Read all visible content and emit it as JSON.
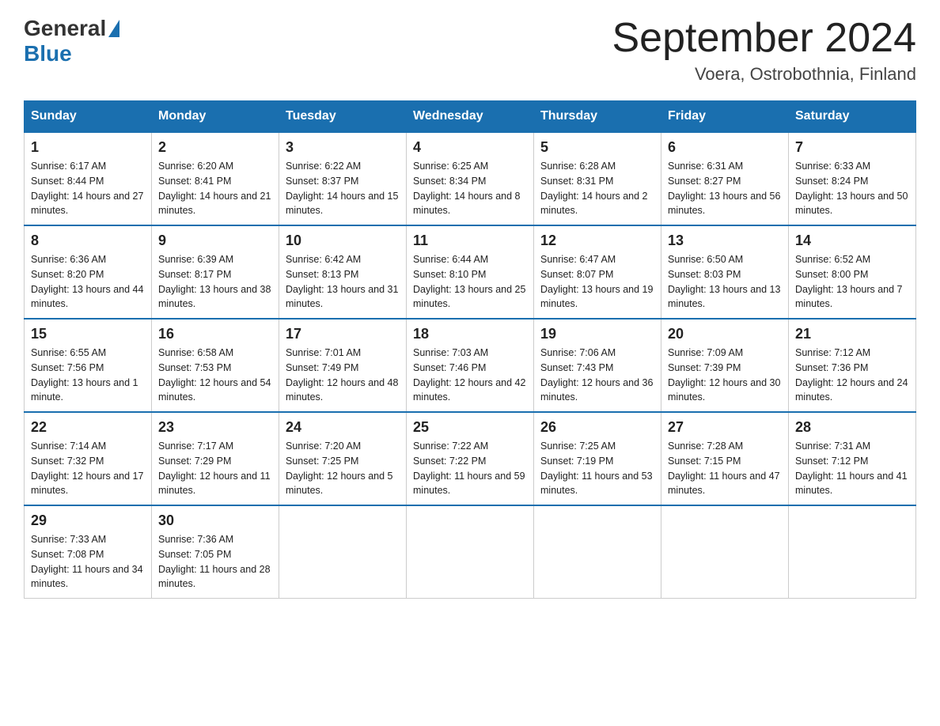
{
  "header": {
    "logo_general": "General",
    "logo_blue": "Blue",
    "month_title": "September 2024",
    "location": "Voera, Ostrobothnia, Finland"
  },
  "days_of_week": [
    "Sunday",
    "Monday",
    "Tuesday",
    "Wednesday",
    "Thursday",
    "Friday",
    "Saturday"
  ],
  "weeks": [
    [
      {
        "day": "1",
        "sunrise": "6:17 AM",
        "sunset": "8:44 PM",
        "daylight": "14 hours and 27 minutes."
      },
      {
        "day": "2",
        "sunrise": "6:20 AM",
        "sunset": "8:41 PM",
        "daylight": "14 hours and 21 minutes."
      },
      {
        "day": "3",
        "sunrise": "6:22 AM",
        "sunset": "8:37 PM",
        "daylight": "14 hours and 15 minutes."
      },
      {
        "day": "4",
        "sunrise": "6:25 AM",
        "sunset": "8:34 PM",
        "daylight": "14 hours and 8 minutes."
      },
      {
        "day": "5",
        "sunrise": "6:28 AM",
        "sunset": "8:31 PM",
        "daylight": "14 hours and 2 minutes."
      },
      {
        "day": "6",
        "sunrise": "6:31 AM",
        "sunset": "8:27 PM",
        "daylight": "13 hours and 56 minutes."
      },
      {
        "day": "7",
        "sunrise": "6:33 AM",
        "sunset": "8:24 PM",
        "daylight": "13 hours and 50 minutes."
      }
    ],
    [
      {
        "day": "8",
        "sunrise": "6:36 AM",
        "sunset": "8:20 PM",
        "daylight": "13 hours and 44 minutes."
      },
      {
        "day": "9",
        "sunrise": "6:39 AM",
        "sunset": "8:17 PM",
        "daylight": "13 hours and 38 minutes."
      },
      {
        "day": "10",
        "sunrise": "6:42 AM",
        "sunset": "8:13 PM",
        "daylight": "13 hours and 31 minutes."
      },
      {
        "day": "11",
        "sunrise": "6:44 AM",
        "sunset": "8:10 PM",
        "daylight": "13 hours and 25 minutes."
      },
      {
        "day": "12",
        "sunrise": "6:47 AM",
        "sunset": "8:07 PM",
        "daylight": "13 hours and 19 minutes."
      },
      {
        "day": "13",
        "sunrise": "6:50 AM",
        "sunset": "8:03 PM",
        "daylight": "13 hours and 13 minutes."
      },
      {
        "day": "14",
        "sunrise": "6:52 AM",
        "sunset": "8:00 PM",
        "daylight": "13 hours and 7 minutes."
      }
    ],
    [
      {
        "day": "15",
        "sunrise": "6:55 AM",
        "sunset": "7:56 PM",
        "daylight": "13 hours and 1 minute."
      },
      {
        "day": "16",
        "sunrise": "6:58 AM",
        "sunset": "7:53 PM",
        "daylight": "12 hours and 54 minutes."
      },
      {
        "day": "17",
        "sunrise": "7:01 AM",
        "sunset": "7:49 PM",
        "daylight": "12 hours and 48 minutes."
      },
      {
        "day": "18",
        "sunrise": "7:03 AM",
        "sunset": "7:46 PM",
        "daylight": "12 hours and 42 minutes."
      },
      {
        "day": "19",
        "sunrise": "7:06 AM",
        "sunset": "7:43 PM",
        "daylight": "12 hours and 36 minutes."
      },
      {
        "day": "20",
        "sunrise": "7:09 AM",
        "sunset": "7:39 PM",
        "daylight": "12 hours and 30 minutes."
      },
      {
        "day": "21",
        "sunrise": "7:12 AM",
        "sunset": "7:36 PM",
        "daylight": "12 hours and 24 minutes."
      }
    ],
    [
      {
        "day": "22",
        "sunrise": "7:14 AM",
        "sunset": "7:32 PM",
        "daylight": "12 hours and 17 minutes."
      },
      {
        "day": "23",
        "sunrise": "7:17 AM",
        "sunset": "7:29 PM",
        "daylight": "12 hours and 11 minutes."
      },
      {
        "day": "24",
        "sunrise": "7:20 AM",
        "sunset": "7:25 PM",
        "daylight": "12 hours and 5 minutes."
      },
      {
        "day": "25",
        "sunrise": "7:22 AM",
        "sunset": "7:22 PM",
        "daylight": "11 hours and 59 minutes."
      },
      {
        "day": "26",
        "sunrise": "7:25 AM",
        "sunset": "7:19 PM",
        "daylight": "11 hours and 53 minutes."
      },
      {
        "day": "27",
        "sunrise": "7:28 AM",
        "sunset": "7:15 PM",
        "daylight": "11 hours and 47 minutes."
      },
      {
        "day": "28",
        "sunrise": "7:31 AM",
        "sunset": "7:12 PM",
        "daylight": "11 hours and 41 minutes."
      }
    ],
    [
      {
        "day": "29",
        "sunrise": "7:33 AM",
        "sunset": "7:08 PM",
        "daylight": "11 hours and 34 minutes."
      },
      {
        "day": "30",
        "sunrise": "7:36 AM",
        "sunset": "7:05 PM",
        "daylight": "11 hours and 28 minutes."
      },
      null,
      null,
      null,
      null,
      null
    ]
  ]
}
